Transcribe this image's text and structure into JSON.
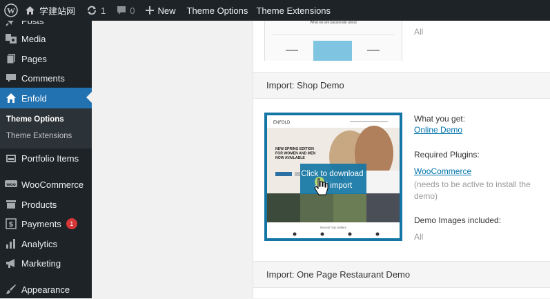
{
  "adminbar": {
    "site_name": "学建站网",
    "updates_count": "1",
    "comments_count": "0",
    "new_label": "New",
    "theme_options_label": "Theme Options",
    "theme_extensions_label": "Theme Extensions"
  },
  "sidebar": {
    "items": [
      {
        "label": "Posts",
        "icon": "pin-icon"
      },
      {
        "label": "Media",
        "icon": "media-icon"
      },
      {
        "label": "Pages",
        "icon": "pages-icon"
      },
      {
        "label": "Comments",
        "icon": "comment-icon"
      },
      {
        "label": "Enfold",
        "icon": "home-icon"
      },
      {
        "label": "Portfolio Items",
        "icon": "portfolio-icon"
      },
      {
        "label": "WooCommerce",
        "icon": "woo-icon"
      },
      {
        "label": "Products",
        "icon": "archive-icon"
      },
      {
        "label": "Payments",
        "icon": "dollar-icon",
        "badge": "1"
      },
      {
        "label": "Analytics",
        "icon": "bar-chart-icon"
      },
      {
        "label": "Marketing",
        "icon": "megaphone-icon"
      },
      {
        "label": "Appearance",
        "icon": "brush-icon"
      }
    ],
    "submenu": [
      {
        "label": "Theme Options",
        "active": true
      },
      {
        "label": "Theme Extensions",
        "active": false
      }
    ]
  },
  "top_section": {
    "thumb_caption": "What we are passionate about",
    "all_label": "All"
  },
  "shop_demo": {
    "heading": "Import: Shop Demo",
    "what_you_get_label": "What you get:",
    "online_demo_link": "Online Demo",
    "required_plugins_label": "Required Plugins:",
    "woocommerce_link": "WooCommerce",
    "plugin_note": "(needs to be active to install the demo)",
    "demo_images_label": "Demo Images included:",
    "demo_images_value": "All",
    "thumb_logo": "ENFOLD",
    "thumb_headline": "NEW SPRING EDITION FOR WOMEN AND MEN NOW AVAILABLE",
    "overlay_text": "Click to download and import",
    "thumb_footer": "Recent Top Sellers"
  },
  "restaurant_demo": {
    "heading": "Import: One Page Restaurant Demo"
  },
  "colors": {
    "admin_dark": "#1d2327",
    "accent_blue": "#2271b1",
    "thumb_border": "#1476a5",
    "link": "#0073aa"
  }
}
